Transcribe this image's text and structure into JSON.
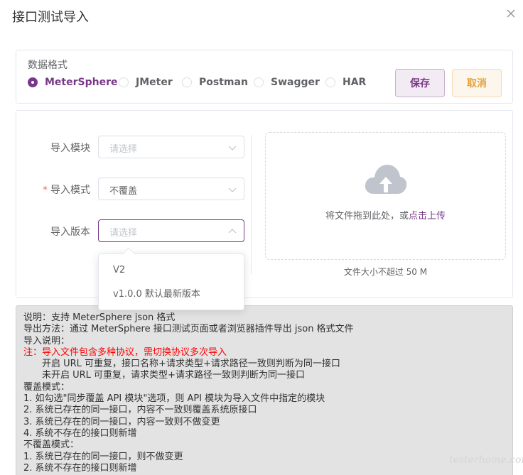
{
  "dialog": {
    "title": "接口测试导入",
    "close_icon": "close-icon"
  },
  "format": {
    "label": "数据格式",
    "options": [
      "MeterSphere",
      "JMeter",
      "Postman",
      "Swagger",
      "HAR"
    ],
    "selected": "MeterSphere",
    "save_label": "保存",
    "cancel_label": "取消"
  },
  "form": {
    "module": {
      "label": "导入模块",
      "placeholder": "请选择"
    },
    "mode": {
      "label": "导入模式",
      "required_mark": "*",
      "value": "不覆盖"
    },
    "version": {
      "label": "导入版本",
      "placeholder": "请选择"
    }
  },
  "version_dropdown": {
    "options": [
      "V2",
      "v1.0.0 默认最新版本"
    ]
  },
  "upload": {
    "icon": "cloud-upload-icon",
    "text_prefix": "将文件拖到此处，或",
    "link_text": "点击上传",
    "tip": "文件大小不超过 50 M"
  },
  "instructions": {
    "lines": [
      "说明：支持 MeterSphere json 格式",
      "导出方法：通过 MeterSphere 接口测试页面或者浏览器插件导出 json 格式文件",
      "导入说明：",
      "注：导入文件包含多种协议，需切换协议多次导入",
      "开启 URL 可重复，接口名称+请求类型+请求路径一致则判断为同一接口",
      "未开启 URL 可重复，请求类型+请求路径一致则判断为同一接口",
      "覆盖模式：",
      "1. 如勾选\"同步覆盖 API 模块\"选项，则 API 模块为导入文件中指定的模块",
      "2. 系统已存在的同一接口，内容不一致则覆盖系统原接口",
      "3. 系统已存在的同一接口，内容一致则不做变更",
      "4. 系统不存在的接口则新增",
      "不覆盖模式：",
      "1. 系统已存在的同一接口，则不做变更",
      "2. 系统不存在的接口则新增"
    ]
  },
  "colors": {
    "accent": "#783887",
    "cancel": "#e6a23c",
    "warning_text": "#ff0000"
  },
  "watermark": "testerhome.com"
}
